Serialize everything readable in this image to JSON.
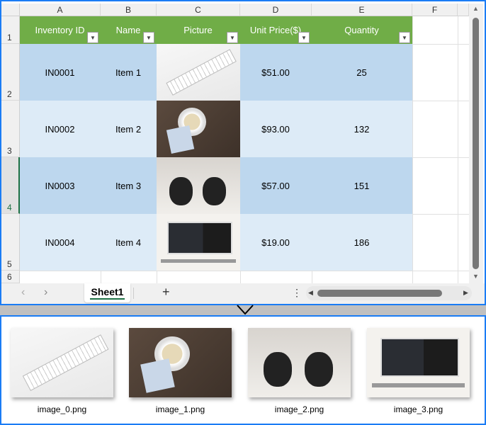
{
  "columns": [
    "A",
    "B",
    "C",
    "D",
    "E",
    "F"
  ],
  "rows": [
    "1",
    "2",
    "3",
    "4",
    "5",
    "6"
  ],
  "table": {
    "headers": [
      "Inventory ID",
      "Name",
      "Picture",
      "Unit Price($)",
      "Quantity"
    ],
    "records": [
      {
        "id": "IN0001",
        "name": "Item 1",
        "price": "$51.00",
        "qty": "25"
      },
      {
        "id": "IN0002",
        "name": "Item 2",
        "price": "$93.00",
        "qty": "132"
      },
      {
        "id": "IN0003",
        "name": "Item 3",
        "price": "$57.00",
        "qty": "151"
      },
      {
        "id": "IN0004",
        "name": "Item 4",
        "price": "$19.00",
        "qty": "186"
      }
    ]
  },
  "sheet_tab": "Sheet1",
  "add_sheet": "+",
  "images": [
    "image_0.png",
    "image_1.png",
    "image_2.png",
    "image_3.png"
  ],
  "colors": {
    "header": "#70ad47",
    "band_dark": "#bdd7ee",
    "band_light": "#ddebf7",
    "accent": "#1a7cf5",
    "tab_underline": "#1e7145"
  }
}
